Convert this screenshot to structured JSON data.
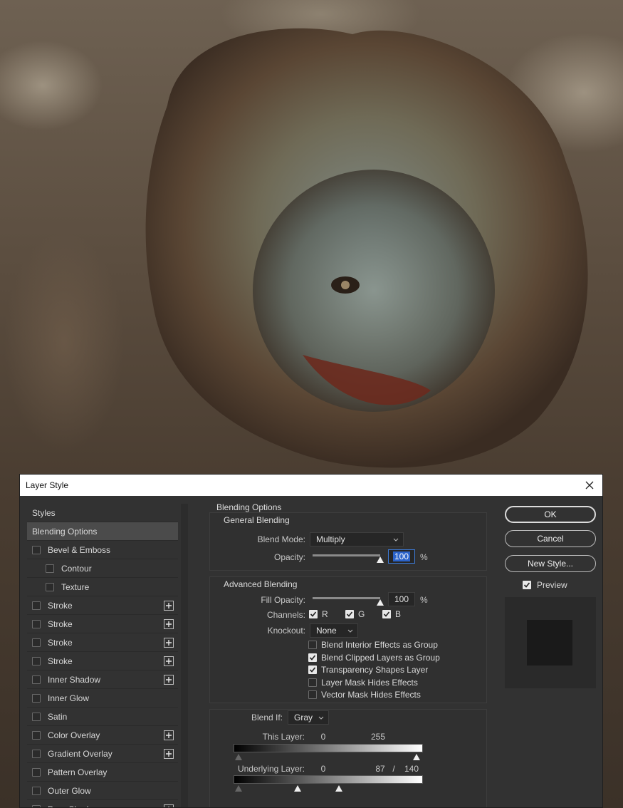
{
  "dialog": {
    "title": "Layer Style"
  },
  "styles_list": [
    {
      "label": "Styles",
      "kind": "header",
      "checked": false,
      "plus": false
    },
    {
      "label": "Blending Options",
      "kind": "active",
      "checked": false,
      "plus": false
    },
    {
      "label": "Bevel & Emboss",
      "kind": "item",
      "checked": false,
      "plus": false
    },
    {
      "label": "Contour",
      "kind": "sub",
      "checked": false,
      "plus": false
    },
    {
      "label": "Texture",
      "kind": "sub",
      "checked": false,
      "plus": false
    },
    {
      "label": "Stroke",
      "kind": "item",
      "checked": false,
      "plus": true
    },
    {
      "label": "Stroke",
      "kind": "item",
      "checked": false,
      "plus": true
    },
    {
      "label": "Stroke",
      "kind": "item",
      "checked": false,
      "plus": true
    },
    {
      "label": "Stroke",
      "kind": "item",
      "checked": false,
      "plus": true
    },
    {
      "label": "Inner Shadow",
      "kind": "item",
      "checked": false,
      "plus": true
    },
    {
      "label": "Inner Glow",
      "kind": "item",
      "checked": false,
      "plus": false
    },
    {
      "label": "Satin",
      "kind": "item",
      "checked": false,
      "plus": false
    },
    {
      "label": "Color Overlay",
      "kind": "item",
      "checked": false,
      "plus": true
    },
    {
      "label": "Gradient Overlay",
      "kind": "item",
      "checked": false,
      "plus": true
    },
    {
      "label": "Pattern Overlay",
      "kind": "item",
      "checked": false,
      "plus": false
    },
    {
      "label": "Outer Glow",
      "kind": "item",
      "checked": false,
      "plus": false
    },
    {
      "label": "Drop Shadow",
      "kind": "item",
      "checked": false,
      "plus": true
    }
  ],
  "blending": {
    "section_title": "Blending Options",
    "general_title": "General Blending",
    "blend_mode_label": "Blend Mode:",
    "blend_mode_value": "Multiply",
    "opacity_label": "Opacity:",
    "opacity_value": "100",
    "percent": "%",
    "advanced_title": "Advanced Blending",
    "fill_opacity_label": "Fill Opacity:",
    "fill_opacity_value": "100",
    "channels_label": "Channels:",
    "channel_r": "R",
    "channel_g": "G",
    "channel_b": "B",
    "knockout_label": "Knockout:",
    "knockout_value": "None",
    "options": [
      {
        "label": "Blend Interior Effects as Group",
        "checked": false
      },
      {
        "label": "Blend Clipped Layers as Group",
        "checked": true
      },
      {
        "label": "Transparency Shapes Layer",
        "checked": true
      },
      {
        "label": "Layer Mask Hides Effects",
        "checked": false
      },
      {
        "label": "Vector Mask Hides Effects",
        "checked": false
      }
    ],
    "blend_if_label": "Blend If:",
    "blend_if_value": "Gray",
    "this_layer_label": "This Layer:",
    "this_layer_low": "0",
    "this_layer_high": "255",
    "underlying_label": "Underlying Layer:",
    "underlying_low": "0",
    "underlying_split_a": "87",
    "underlying_slash": "/",
    "underlying_split_b": "140"
  },
  "buttons": {
    "ok": "OK",
    "cancel": "Cancel",
    "new_style": "New Style...",
    "preview": "Preview"
  }
}
